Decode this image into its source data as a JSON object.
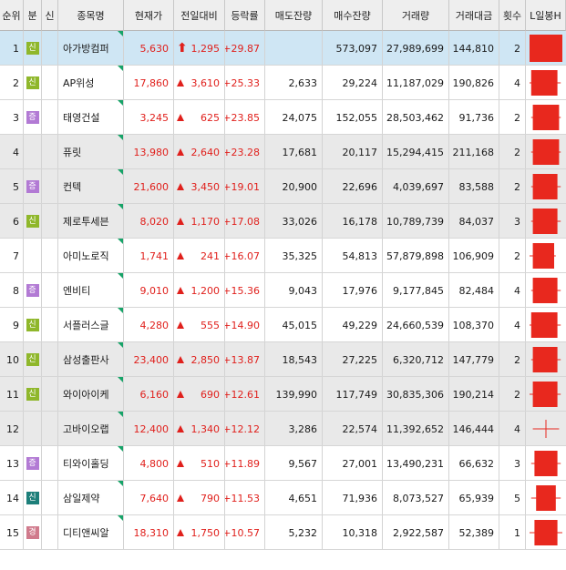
{
  "columns": [
    "순위",
    "분",
    "신",
    "종목명",
    "현재가",
    "전일대비",
    "등락률",
    "매도잔량",
    "매수잔량",
    "거래량",
    "거래대금",
    "횟수",
    "L일봉H"
  ],
  "rows": [
    {
      "rank": "1",
      "badge": "신",
      "badge_type": "new",
      "name": "아가방컴퍼",
      "price": "5,630",
      "arrow": "upper-limit",
      "diff": "1,295",
      "rate": "+29.87",
      "ask": "",
      "bid": "573,097",
      "volume": "27,989,699",
      "amount": "144,810",
      "count": "2",
      "candle": {
        "high": 1.0,
        "low": 0.0,
        "open": 0.0,
        "close": 1.0
      }
    },
    {
      "rank": "2",
      "badge": "신",
      "badge_type": "new",
      "name": "AP위성",
      "price": "17,860",
      "arrow": "up",
      "diff": "3,610",
      "rate": "+25.33",
      "ask": "2,633",
      "bid": "29,224",
      "volume": "11,187,029",
      "amount": "190,826",
      "count": "4",
      "candle": {
        "high": 0.95,
        "low": 0.0,
        "open": 0.05,
        "close": 0.85
      }
    },
    {
      "rank": "3",
      "badge": "증",
      "badge_type": "jeung",
      "name": "태영건설",
      "price": "3,245",
      "arrow": "up",
      "diff": "625",
      "rate": "+23.85",
      "ask": "24,075",
      "bid": "152,055",
      "volume": "28,503,462",
      "amount": "91,736",
      "count": "2",
      "candle": {
        "high": 0.95,
        "low": 0.05,
        "open": 0.1,
        "close": 0.9
      }
    },
    {
      "rank": "4",
      "badge": "",
      "badge_type": "",
      "name": "퓨릿",
      "price": "13,980",
      "arrow": "up",
      "diff": "2,640",
      "rate": "+23.28",
      "ask": "17,681",
      "bid": "20,117",
      "volume": "15,294,415",
      "amount": "211,168",
      "count": "2",
      "candle": {
        "high": 0.95,
        "low": 0.05,
        "open": 0.1,
        "close": 0.9
      }
    },
    {
      "rank": "5",
      "badge": "증",
      "badge_type": "jeung",
      "name": "컨텍",
      "price": "21,600",
      "arrow": "up",
      "diff": "3,450",
      "rate": "+19.01",
      "ask": "20,900",
      "bid": "22,696",
      "volume": "4,039,697",
      "amount": "83,588",
      "count": "2",
      "candle": {
        "high": 0.95,
        "low": 0.05,
        "open": 0.1,
        "close": 0.85
      }
    },
    {
      "rank": "6",
      "badge": "신",
      "badge_type": "new",
      "name": "제로투세븐",
      "price": "8,020",
      "arrow": "up",
      "diff": "1,170",
      "rate": "+17.08",
      "ask": "33,026",
      "bid": "16,178",
      "volume": "10,789,739",
      "amount": "84,037",
      "count": "3",
      "candle": {
        "high": 0.95,
        "low": 0.05,
        "open": 0.1,
        "close": 0.85
      }
    },
    {
      "rank": "7",
      "badge": "",
      "badge_type": "",
      "name": "아미노로직",
      "price": "1,741",
      "arrow": "up",
      "diff": "241",
      "rate": "+16.07",
      "ask": "35,325",
      "bid": "54,813",
      "volume": "57,879,898",
      "amount": "106,909",
      "count": "2",
      "candle": {
        "high": 0.8,
        "low": 0.0,
        "open": 0.1,
        "close": 0.75
      }
    },
    {
      "rank": "8",
      "badge": "증",
      "badge_type": "jeung",
      "name": "엔비티",
      "price": "9,010",
      "arrow": "up",
      "diff": "1,200",
      "rate": "+15.36",
      "ask": "9,043",
      "bid": "17,976",
      "volume": "9,177,845",
      "amount": "82,484",
      "count": "4",
      "candle": {
        "high": 0.95,
        "low": 0.05,
        "open": 0.1,
        "close": 0.85
      }
    },
    {
      "rank": "9",
      "badge": "신",
      "badge_type": "new",
      "name": "서플러스글",
      "price": "4,280",
      "arrow": "up",
      "diff": "555",
      "rate": "+14.90",
      "ask": "45,015",
      "bid": "49,229",
      "volume": "24,660,539",
      "amount": "108,370",
      "count": "4",
      "candle": {
        "high": 0.95,
        "low": 0.0,
        "open": 0.05,
        "close": 0.85
      }
    },
    {
      "rank": "10",
      "badge": "신",
      "badge_type": "new",
      "name": "삼성출판사",
      "price": "23,400",
      "arrow": "up",
      "diff": "2,850",
      "rate": "+13.87",
      "ask": "18,543",
      "bid": "27,225",
      "volume": "6,320,712",
      "amount": "147,779",
      "count": "2",
      "candle": {
        "high": 0.95,
        "low": 0.05,
        "open": 0.1,
        "close": 0.85
      }
    },
    {
      "rank": "11",
      "badge": "신",
      "badge_type": "new",
      "name": "와이아이케",
      "price": "6,160",
      "arrow": "up",
      "diff": "690",
      "rate": "+12.61",
      "ask": "139,990",
      "bid": "117,749",
      "volume": "30,835,306",
      "amount": "190,214",
      "count": "2",
      "candle": {
        "high": 0.95,
        "low": 0.0,
        "open": 0.1,
        "close": 0.85
      }
    },
    {
      "rank": "12",
      "badge": "",
      "badge_type": "",
      "name": "고바이오랩",
      "price": "12,400",
      "arrow": "up",
      "diff": "1,340",
      "rate": "+12.12",
      "ask": "3,286",
      "bid": "22,574",
      "volume": "11,392,652",
      "amount": "146,444",
      "count": "4",
      "candle": {
        "high": 0.9,
        "low": 0.1,
        "open": 0.5,
        "close": 0.5
      }
    },
    {
      "rank": "13",
      "badge": "증",
      "badge_type": "jeung",
      "name": "티와이홀딩",
      "price": "4,800",
      "arrow": "up",
      "diff": "510",
      "rate": "+11.89",
      "ask": "9,567",
      "bid": "27,001",
      "volume": "13,490,231",
      "amount": "66,632",
      "count": "3",
      "candle": {
        "high": 0.95,
        "low": 0.05,
        "open": 0.15,
        "close": 0.85
      }
    },
    {
      "rank": "14",
      "badge": "신",
      "badge_type": "sin2",
      "name": "삼일제약",
      "price": "7,640",
      "arrow": "up",
      "diff": "790",
      "rate": "+11.53",
      "ask": "4,651",
      "bid": "71,936",
      "volume": "8,073,527",
      "amount": "65,939",
      "count": "5",
      "candle": {
        "high": 0.95,
        "low": 0.05,
        "open": 0.2,
        "close": 0.8
      }
    },
    {
      "rank": "15",
      "badge": "경",
      "badge_type": "gyeong",
      "name": "디티앤씨알",
      "price": "18,310",
      "arrow": "up",
      "diff": "1,750",
      "rate": "+10.57",
      "ask": "5,232",
      "bid": "10,318",
      "volume": "2,922,587",
      "amount": "52,389",
      "count": "1",
      "candle": {
        "high": 1.0,
        "low": 0.0,
        "open": 0.15,
        "close": 0.85
      }
    }
  ],
  "colors": {
    "up": "#e0201c",
    "candle": "#e8281e",
    "corner_mark": "#17a368",
    "header_bg": "#eeeeee",
    "row_shade": "#e9e9e9",
    "row_selected": "#cfe6f4"
  }
}
